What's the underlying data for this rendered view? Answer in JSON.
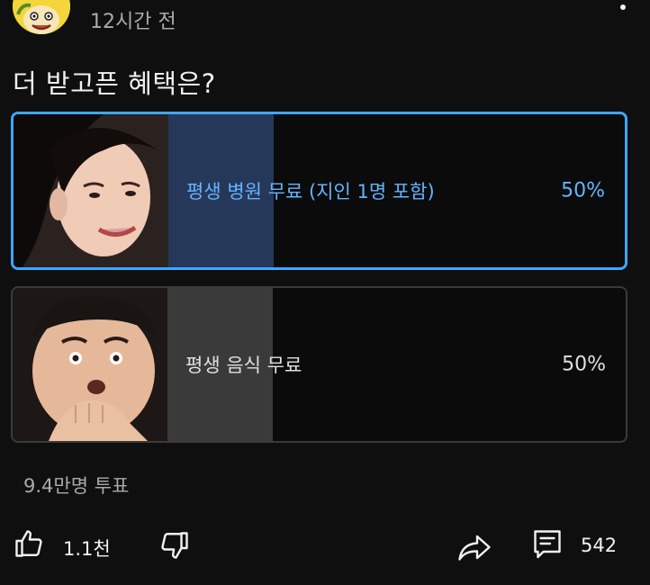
{
  "post": {
    "timestamp": "12시간 전",
    "question": "더 받고픈 혜택은?"
  },
  "poll": {
    "options": [
      {
        "label": "평생 병원 무료 (지인 1명 포함)",
        "percent_text": "50%",
        "percent": 50,
        "selected": true
      },
      {
        "label": "평생 음식 무료",
        "percent_text": "50%",
        "percent": 50,
        "selected": false
      }
    ],
    "vote_count": "9.4만명 투표"
  },
  "actions": {
    "like_count": "1.1천",
    "comment_count": "542"
  },
  "icons": {
    "avatar": "cartoon-avatar-icon",
    "more": "more-vertical-icon",
    "like": "thumbs-up-icon",
    "dislike": "thumbs-down-icon",
    "share": "share-arrow-icon",
    "comment": "comment-icon"
  },
  "colors": {
    "background": "#0f0f0f",
    "selected_border": "#3ea6ff",
    "selected_fill": "#263859",
    "selected_text": "#65b3ff",
    "unselected_fill": "#3a3a3a",
    "secondary_text": "#aaaaaa"
  }
}
